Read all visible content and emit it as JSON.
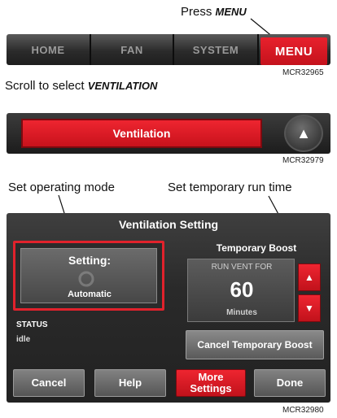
{
  "panel1": {
    "instruction_prefix": "Press",
    "instruction_emphasis": "MENU",
    "buttons": [
      {
        "label": "HOME"
      },
      {
        "label": "FAN"
      },
      {
        "label": "SYSTEM"
      },
      {
        "label": "MENU"
      }
    ],
    "figure_code": "MCR32965"
  },
  "panel2": {
    "instruction_prefix": "Scroll to select",
    "instruction_emphasis": "VENTILATION",
    "selected_item": "Ventilation",
    "up_arrow": "▲",
    "figure_code": "MCR32979"
  },
  "panel3": {
    "callout_left": "Set operating mode",
    "callout_right": "Set temporary run time",
    "screen_title": "Ventilation Setting",
    "setting": {
      "label": "Setting:",
      "mode": "Automatic",
      "icon": "fan-icon"
    },
    "status": {
      "label": "STATUS",
      "value": "idle"
    },
    "temporary_boost": {
      "title": "Temporary Boost",
      "label": "RUN VENT FOR",
      "value": "60",
      "unit": "Minutes",
      "up": "▲",
      "down": "▼"
    },
    "cancel_boost": "Cancel Temporary Boost",
    "bottom_buttons": {
      "cancel": "Cancel",
      "help": "Help",
      "more_settings": "More Settings",
      "done": "Done"
    },
    "figure_code": "MCR32980"
  },
  "colors": {
    "accent_red": "#e1222c",
    "screen_dark": "#2a2a2a",
    "button_gray": "#6e6e6e"
  }
}
